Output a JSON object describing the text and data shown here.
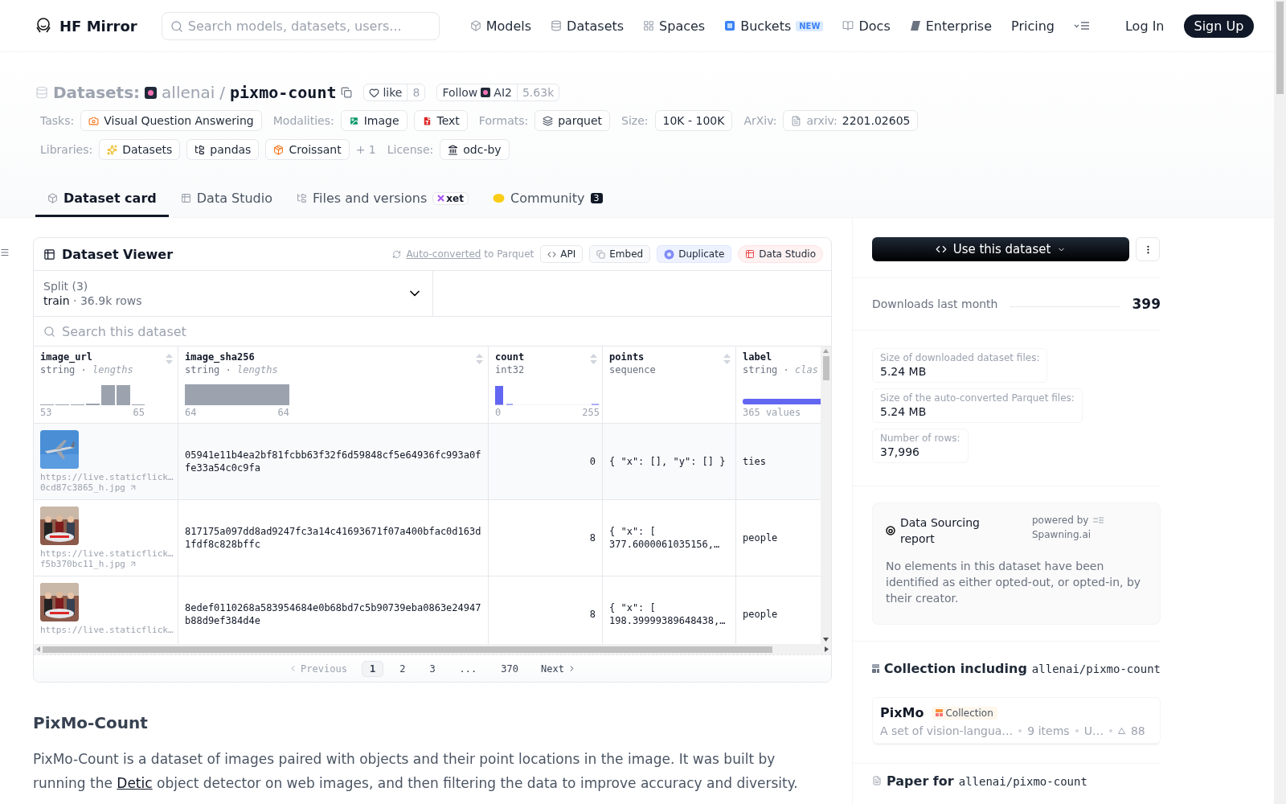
{
  "nav": {
    "brand": "HF Mirror",
    "search": {
      "placeholder": "Search models, datasets, users..."
    },
    "links": [
      {
        "label": "Models"
      },
      {
        "label": "Datasets"
      },
      {
        "label": "Spaces"
      },
      {
        "label": "Buckets",
        "badge": "NEW"
      },
      {
        "label": "Docs"
      },
      {
        "label": "Enterprise"
      },
      {
        "label": "Pricing"
      }
    ],
    "login": "Log In",
    "signup": "Sign Up"
  },
  "header": {
    "section": "Datasets:",
    "owner": "allenai",
    "separator": "/",
    "name": "pixmo-count",
    "like": {
      "label": "like",
      "count": "8"
    },
    "follow": {
      "label": "Follow",
      "org": "AI2",
      "count": "5.63k"
    }
  },
  "tag_rows": [
    {
      "groups": [
        {
          "label": "Tasks:",
          "tags": [
            {
              "text": "Visual Question Answering"
            }
          ]
        },
        {
          "label": "Modalities:",
          "tags": [
            {
              "text": "Image"
            },
            {
              "text": "Text"
            }
          ]
        },
        {
          "label": "Formats:",
          "tags": [
            {
              "text": "parquet"
            }
          ]
        },
        {
          "label": "Size:",
          "tags": [
            {
              "text": "10K - 100K"
            }
          ]
        },
        {
          "label": "ArXiv:",
          "tags": [
            {
              "prefix": "arxiv:",
              "text": "2201.02605"
            }
          ]
        }
      ]
    },
    {
      "groups": [
        {
          "label": "Libraries:",
          "tags": [
            {
              "text": "Datasets"
            },
            {
              "text": "pandas"
            },
            {
              "text": "Croissant"
            }
          ],
          "more": "+ 1"
        },
        {
          "label": "License:",
          "tags": [
            {
              "text": "odc-by"
            }
          ]
        }
      ]
    }
  ],
  "tabs": [
    {
      "label": "Dataset card",
      "selected": true
    },
    {
      "label": "Data Studio",
      "selected": false
    },
    {
      "label": "Files and versions",
      "selected": false,
      "badge": "xet"
    },
    {
      "label": "Community",
      "selected": false,
      "count": "3"
    }
  ],
  "viewer": {
    "title": "Dataset Viewer",
    "converted_link": "Auto-converted",
    "converted_rest": "to Parquet",
    "actions": [
      {
        "label": "API",
        "kind": "api"
      },
      {
        "label": "Embed",
        "kind": "embed"
      },
      {
        "label": "Duplicate",
        "kind": "duplicate"
      },
      {
        "label": "Data Studio",
        "kind": "studio"
      }
    ],
    "split": {
      "label": "Split (3)",
      "value": "train",
      "dot": "·",
      "rows": "36.9k rows"
    },
    "search": {
      "placeholder": "Search this dataset"
    },
    "columns": [
      {
        "name": "image_url",
        "type": "string",
        "separator": "·",
        "stat": "lengths",
        "kind": "lengths",
        "min": "53",
        "max": "65"
      },
      {
        "name": "image_sha256",
        "type": "string",
        "separator": "·",
        "stat": "lengths",
        "kind": "single",
        "min": "64",
        "max": "64"
      },
      {
        "name": "count",
        "type": "int32",
        "kind": "int",
        "min": "0",
        "max": "255"
      },
      {
        "name": "points",
        "type": "sequence",
        "kind": "none"
      },
      {
        "name": "label",
        "type": "string",
        "separator": "·",
        "stat": "clas",
        "kind": "class",
        "summary": "365 values"
      }
    ],
    "rows": [
      {
        "url": "https://live.staticflick…",
        "url2": "0cd87c3865_h.jpg",
        "sha": "05941e11b4ea2bf81fcbb63f32f6d59848cf5e64936fc993a0ffe33a54c0c9fa",
        "count": "0",
        "points": "{ \"x\": [], \"y\": [] }",
        "label": "ties"
      },
      {
        "url": "https://live.staticflick…",
        "url2": "f5b370bc11_h.jpg",
        "sha": "817175a097dd8ad9247fc3a14c41693671f07a400bfac0d163d1fdf8c828bffc",
        "count": "8",
        "points": "{ \"x\": [\n377.6000061035156,…",
        "label": "people"
      },
      {
        "url": "https://live.staticflick…",
        "sha": "8edef0110268a583954684e0b68bd7c5b90739eba0863e24947b88d9ef384d4e",
        "count": "8",
        "points": "{ \"x\": [\n198.39999389648438,…",
        "label": "people"
      }
    ],
    "pages": [
      {
        "label": "1",
        "selected": true
      },
      {
        "label": "2",
        "selected": false
      },
      {
        "label": "3",
        "selected": false
      },
      {
        "label": "...",
        "selected": false
      },
      {
        "label": "370",
        "selected": false
      }
    ],
    "previous": "Previous",
    "next": "Next"
  },
  "card": {
    "heading": "PixMo-Count",
    "before": "PixMo-Count is a dataset of images paired with objects and their point locations in the image. It was built by running the",
    "link": "Detic",
    "after": "object detector on web images, and then filtering the data to improve accuracy and diversity."
  },
  "side": {
    "use_button": "Use this dataset",
    "downloads": {
      "label": "Downloads last month",
      "value": "399"
    },
    "stats": [
      {
        "label": "Size of downloaded dataset files:",
        "value": "5.24 MB"
      },
      {
        "label": "Size of the auto-converted Parquet files:",
        "value": "5.24 MB"
      },
      {
        "label": "Number of rows:",
        "value": "37,996"
      }
    ],
    "sourcing": {
      "title": "Data Sourcing report",
      "powered": "powered by",
      "brand": "Spawning.ai",
      "text": "No elements in this dataset have been identified as either opted-out, or opted-in, by their creator."
    },
    "collection": {
      "heading": "Collection including",
      "repo": "allenai/pixmo-count",
      "title": "PixMo",
      "badge": "Collection",
      "desc": "A set of vision-langua…",
      "items": "9 items",
      "updated": "U…",
      "likes": "88"
    },
    "paper": {
      "heading": "Paper for",
      "repo": "allenai/pixmo-count"
    }
  }
}
